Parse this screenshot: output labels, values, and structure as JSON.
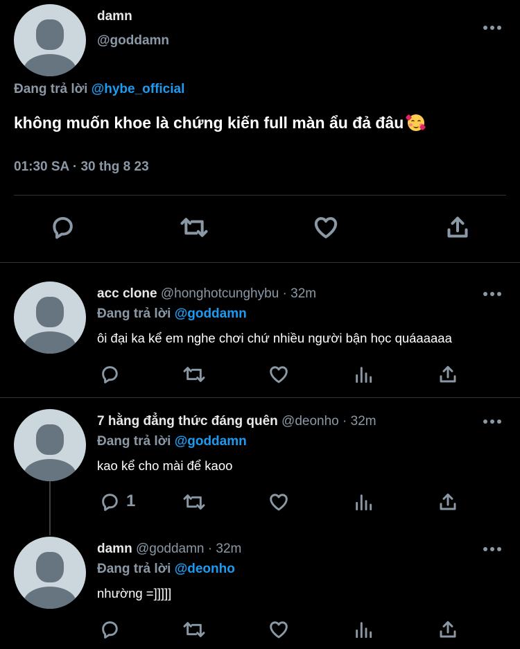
{
  "main_tweet": {
    "display_name": "damn",
    "handle": "@goddamn",
    "replying_prefix": "Đang trả lời",
    "replying_to": "@hybe_official",
    "text": "không muốn khoe là chứng kiến full màn ẩu đả đâu",
    "emoji": "smiling-face-with-hearts-emoji",
    "timestamp": "01:30 SA · 30 thg 8 23"
  },
  "replies": [
    {
      "display_name": "acc clone",
      "handle": "@honghotcunghybu",
      "time": "· 32m",
      "replying_prefix": "Đang trả lời",
      "replying_to": "@goddamn",
      "text": "ôi đại ka kể em nghe chơi chứ nhiều người bận học quáaaaaa",
      "reply_count": ""
    },
    {
      "display_name": "7 hằng đẳng thức đáng quên",
      "handle": "@deonho",
      "time": "· 32m",
      "replying_prefix": "Đang trả lời",
      "replying_to": "@goddamn",
      "text": "kao kể cho mài để kaoo",
      "reply_count": "1"
    },
    {
      "display_name": "damn",
      "handle": "@goddamn",
      "time": "· 32m",
      "replying_prefix": "Đang trả lời",
      "replying_to": "@deonho",
      "text": "nhường =]]]]]",
      "reply_count": ""
    }
  ],
  "colors": {
    "background": "#000000",
    "text": "#e7e9ea",
    "muted": "#8b98a5",
    "accent": "#1d9bf0",
    "divider": "#2f3336"
  }
}
